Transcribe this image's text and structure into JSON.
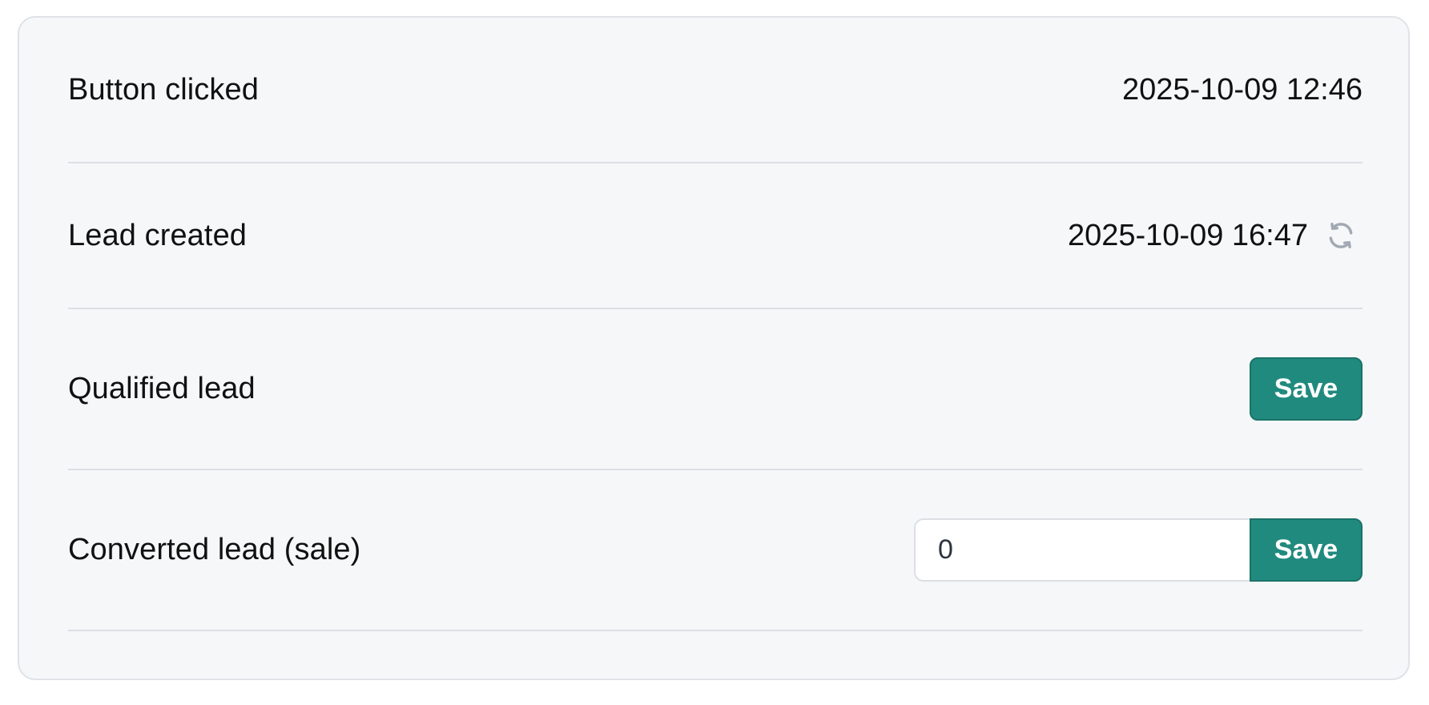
{
  "rows": [
    {
      "label": "Button clicked",
      "value": "2025-10-09 12:46"
    },
    {
      "label": "Lead created",
      "value": "2025-10-09 16:47",
      "icon": "refresh-icon"
    },
    {
      "label": "Qualified lead",
      "button_label": "Save"
    },
    {
      "label": "Converted lead (sale)",
      "input_value": "0",
      "button_label": "Save"
    }
  ],
  "colors": {
    "card_background": "#f6f7f9",
    "card_border": "#dfe2e7",
    "divider": "#dcdfe4",
    "primary_button": "#218a7e",
    "icon_gray": "#a3a9b3"
  }
}
